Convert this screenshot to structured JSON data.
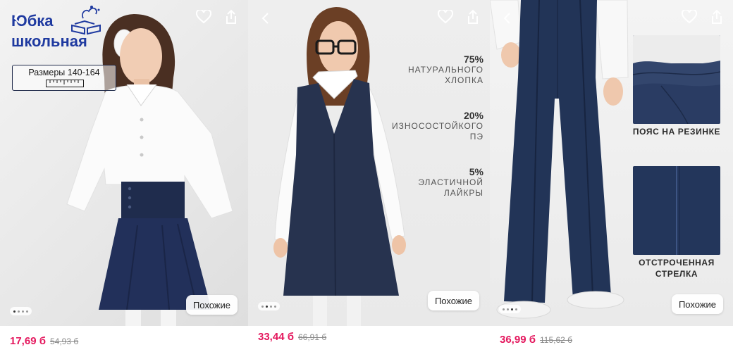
{
  "products": [
    {
      "price": "17,69 б",
      "old_price": "54,93 б",
      "similar_label": "Похожие",
      "overlay": {
        "title_line1": "Юбка",
        "title_line2": "школьная",
        "sizes": "Размеры 140-164"
      },
      "icons": [
        "chevron-left-icon",
        "heart-icon",
        "share-icon",
        "books-logo-icon",
        "ruler-icon"
      ]
    },
    {
      "price": "33,44 б",
      "old_price": "66,91 б",
      "similar_label": "Похожие",
      "composition": [
        {
          "pct": "75%",
          "line1": "НАТУРАЛЬНОГО",
          "line2": "ХЛОПКА"
        },
        {
          "pct": "20%",
          "line1": "ИЗНОСОСТОЙКОГО",
          "line2": "ПЭ"
        },
        {
          "pct": "5%",
          "line1": "ЭЛАСТИЧНОЙ",
          "line2": "ЛАЙКРЫ"
        }
      ],
      "icons": [
        "chevron-left-icon",
        "heart-icon",
        "share-icon"
      ]
    },
    {
      "price": "36,99 б",
      "old_price": "115,62 б",
      "similar_label": "Похожие",
      "details": [
        {
          "line1": "ПОЯС НА РЕЗИНКЕ",
          "line2": ""
        },
        {
          "line1": "ОТСТРОЧЕННАЯ",
          "line2": "СТРЕЛКА"
        }
      ],
      "icons": [
        "chevron-left-icon",
        "heart-icon",
        "share-icon"
      ]
    }
  ],
  "colors": {
    "price": "#e4175d",
    "old_price": "#8a8a8a",
    "navy": "#1e2c4a",
    "promo_blue": "#1f3aa0"
  }
}
